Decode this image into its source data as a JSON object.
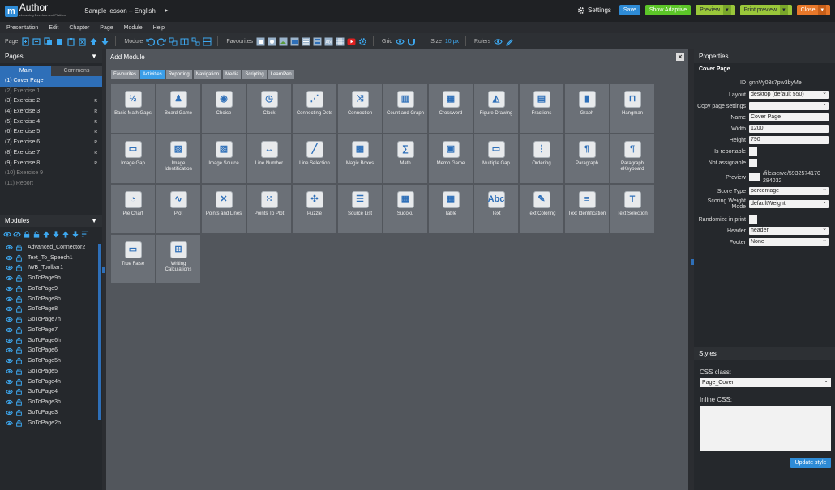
{
  "app": {
    "logo_m": "m",
    "logo_name": "Author",
    "logo_sub": "eLearning Development Platform",
    "lesson_title": "Sample lesson – English",
    "caret": "►"
  },
  "header": {
    "settings_label": "Settings",
    "save_label": "Save",
    "show_adaptive_label": "Show Adaptive",
    "preview_label": "Preview",
    "print_preview_label": "Print preview",
    "close_label": "Close",
    "dropdown_glyph": "▾"
  },
  "menu": [
    "Presentation",
    "Edit",
    "Chapter",
    "Page",
    "Module",
    "Help"
  ],
  "toolbar": {
    "page_label": "Page",
    "module_label": "Module",
    "favourites_label": "Favourites",
    "grid_label": "Grid",
    "size_label": "Size",
    "size_value": "10 px",
    "rulers_label": "Rulers"
  },
  "pages_panel": {
    "title": "Pages",
    "collapse_glyph": "▼",
    "tabs": [
      "Main",
      "Commons"
    ],
    "items": [
      {
        "label": "(1) Cover Page",
        "state": "active",
        "r": ""
      },
      {
        "label": "(2) Exercise 1",
        "state": "disabled",
        "r": ""
      },
      {
        "label": "(3) Exercise 2",
        "state": "normal",
        "r": "R"
      },
      {
        "label": "(4) Exercise 3",
        "state": "normal",
        "r": "R"
      },
      {
        "label": "(5) Exercise 4",
        "state": "normal",
        "r": "R"
      },
      {
        "label": "(6) Exercise 5",
        "state": "normal",
        "r": "R"
      },
      {
        "label": "(7) Exercise 6",
        "state": "normal",
        "r": "R"
      },
      {
        "label": "(8) Exercise 7",
        "state": "normal",
        "r": "R"
      },
      {
        "label": "(9) Exercise 8",
        "state": "normal",
        "r": "R"
      },
      {
        "label": "(10) Exercise 9",
        "state": "disabled",
        "r": ""
      },
      {
        "label": "(11) Report",
        "state": "disabled",
        "r": ""
      }
    ]
  },
  "modules_panel": {
    "title": "Modules",
    "collapse_glyph": "▼",
    "items": [
      "Advanced_Connector2",
      "Text_To_Speech1",
      "IWB_Toolbar1",
      "GoToPage9h",
      "GoToPage9",
      "GoToPage8h",
      "GoToPage8",
      "GoToPage7h",
      "GoToPage7",
      "GoToPage6h",
      "GoToPage6",
      "GoToPage5h",
      "GoToPage5",
      "GoToPage4h",
      "GoToPage4",
      "GoToPage3h",
      "GoToPage3",
      "GoToPage2b"
    ]
  },
  "dialog": {
    "title": "Add Module",
    "close_glyph": "×",
    "categories": [
      "Favourites",
      "Activities",
      "Reporting",
      "Navigation",
      "Media",
      "Scripting",
      "LearnPen"
    ],
    "active_category": "Activities",
    "tiles": [
      {
        "label": "Basic Math Gaps",
        "glyph": "½"
      },
      {
        "label": "Board Game",
        "glyph": "♟"
      },
      {
        "label": "Choice",
        "glyph": "◉"
      },
      {
        "label": "Clock",
        "glyph": "◷"
      },
      {
        "label": "Connecting Dots",
        "glyph": "⋰"
      },
      {
        "label": "Connection",
        "glyph": "⤨"
      },
      {
        "label": "Count and Graph",
        "glyph": "▥"
      },
      {
        "label": "Crossword",
        "glyph": "▦"
      },
      {
        "label": "Figure Drawing",
        "glyph": "◭"
      },
      {
        "label": "Fractions",
        "glyph": "▤"
      },
      {
        "label": "Graph",
        "glyph": "▮"
      },
      {
        "label": "Hangman",
        "glyph": "⊓"
      },
      {
        "label": "Image Gap",
        "glyph": "▭"
      },
      {
        "label": "Image Identification",
        "glyph": "▧"
      },
      {
        "label": "Image Source",
        "glyph": "▨"
      },
      {
        "label": "Line Number",
        "glyph": "↔"
      },
      {
        "label": "Line Selection",
        "glyph": "╱"
      },
      {
        "label": "Magic Boxes",
        "glyph": "▩"
      },
      {
        "label": "Math",
        "glyph": "∑"
      },
      {
        "label": "Memo Game",
        "glyph": "▣"
      },
      {
        "label": "Multiple Gap",
        "glyph": "▭"
      },
      {
        "label": "Ordering",
        "glyph": "⋮"
      },
      {
        "label": "Paragraph",
        "glyph": "¶"
      },
      {
        "label": "Paragraph eKeyboard",
        "glyph": "¶"
      },
      {
        "label": "Pie Chart",
        "glyph": "◔"
      },
      {
        "label": "Plot",
        "glyph": "∿"
      },
      {
        "label": "Points and Lines",
        "glyph": "✕"
      },
      {
        "label": "Points To Plot",
        "glyph": "⁙"
      },
      {
        "label": "Puzzle",
        "glyph": "✣"
      },
      {
        "label": "Source List",
        "glyph": "☰"
      },
      {
        "label": "Sudoku",
        "glyph": "▦"
      },
      {
        "label": "Table",
        "glyph": "▦"
      },
      {
        "label": "Text",
        "glyph": "Abc"
      },
      {
        "label": "Text Coloring",
        "glyph": "✎"
      },
      {
        "label": "Text Identification",
        "glyph": "≡"
      },
      {
        "label": "Text Selection",
        "glyph": "T"
      },
      {
        "label": "True False",
        "glyph": "▭"
      },
      {
        "label": "Writing Calculations",
        "glyph": "⊞"
      }
    ]
  },
  "properties": {
    "title": "Properties",
    "subtitle": "Cover Page",
    "id_label": "ID",
    "id_value": "gnnVy03s7pw3byMe",
    "layout_label": "Layout",
    "layout_value": "desktop (default 550)",
    "copy_label": "Copy page settings",
    "copy_value": "",
    "name_label": "Name",
    "name_value": "Cover Page",
    "width_label": "Width",
    "width_value": "1200",
    "height_label": "Height",
    "height_value": "790",
    "reportable_label": "Is reportable",
    "assignable_label": "Not assignable",
    "preview_label": "Preview",
    "preview_btn": "...",
    "preview_path_1": "/file/serve/5932574170",
    "preview_path_2": "284032",
    "score_type_label": "Score Type",
    "score_type_value": "percentage",
    "scoring_label_1": "Scoring Weight",
    "scoring_label_2": "Mode",
    "scoring_value": "defaultWeight",
    "randomize_label": "Randomize in print",
    "header_label": "Header",
    "header_value": "header",
    "footer_label": "Footer",
    "footer_value": "None"
  },
  "styles": {
    "title": "Styles",
    "css_class_label": "CSS class:",
    "css_class_value": "Page_Cover",
    "inline_css_label": "Inline CSS:",
    "update_label": "Update style"
  },
  "colors": {
    "accent": "#2e8bd6",
    "active_tab": "#2e6fb8",
    "show_adaptive": "#5cc628",
    "preview": "#9ac73a",
    "close": "#e8782a"
  }
}
